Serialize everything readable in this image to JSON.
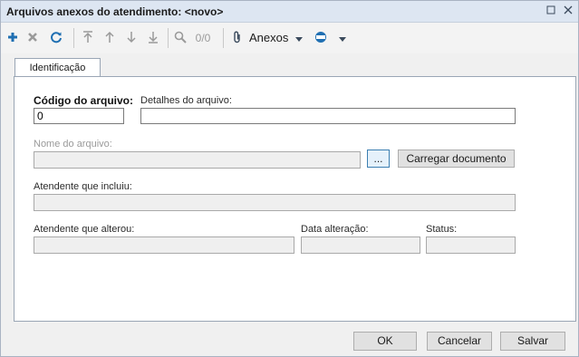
{
  "window": {
    "title": "Arquivos anexos do atendimento: <novo>"
  },
  "toolbar": {
    "counter": "0/0",
    "anexos_label": "Anexos"
  },
  "tabs": [
    {
      "label": "Identificação"
    }
  ],
  "form": {
    "codigo_label": "Código do arquivo:",
    "codigo_value": "0",
    "detalhes_label": "Detalhes do arquivo:",
    "detalhes_value": "",
    "nome_label": "Nome do arquivo:",
    "nome_value": "",
    "browse_label": "...",
    "carregar_label": "Carregar documento",
    "incluiu_label": "Atendente que incluiu:",
    "incluiu_value": "",
    "alterou_label": "Atendente que alterou:",
    "alterou_value": "",
    "data_label": "Data alteração:",
    "data_value": "",
    "status_label": "Status:",
    "status_value": ""
  },
  "footer": {
    "ok_label": "OK",
    "cancel_label": "Cancelar",
    "save_label": "Salvar"
  },
  "colors": {
    "titlebar": "#dde6f2",
    "accent_icon": "#1f6fb2",
    "border": "#9aa6b5"
  }
}
